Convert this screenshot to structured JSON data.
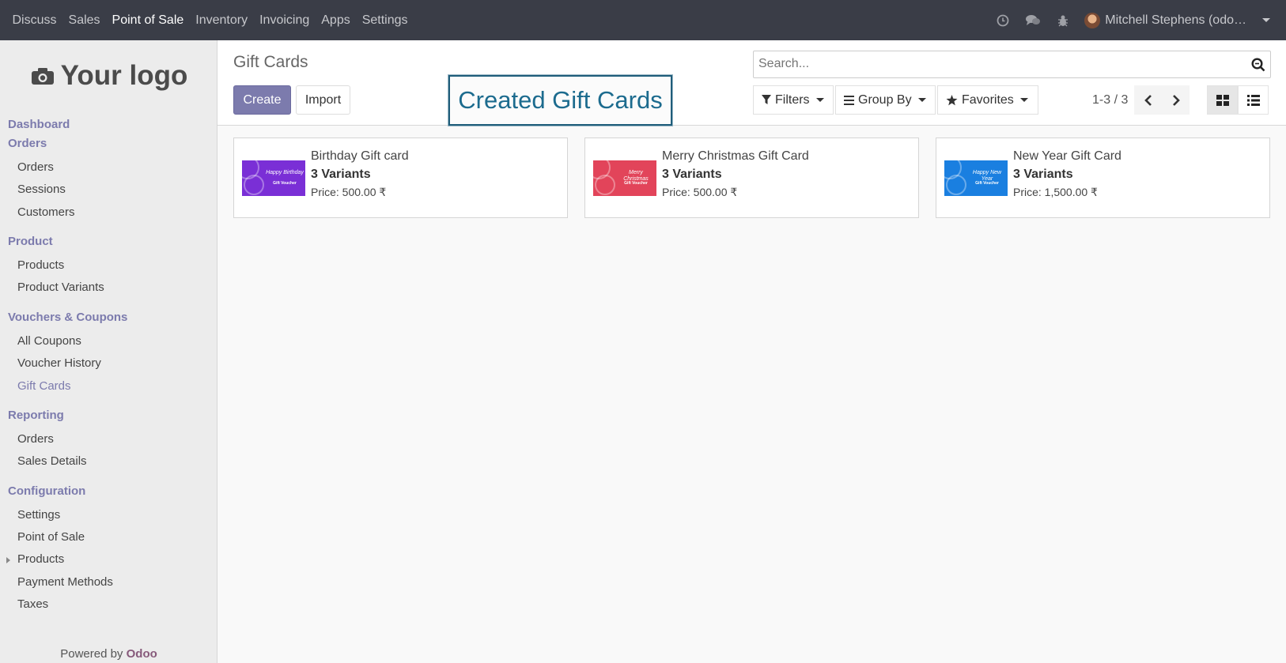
{
  "topbar": {
    "menus": [
      "Discuss",
      "Sales",
      "Point of Sale",
      "Inventory",
      "Invoicing",
      "Apps",
      "Settings"
    ],
    "active_menu": "Point of Sale",
    "user_name": "Mitchell Stephens (odo…",
    "icons": [
      "clock-icon",
      "chat-icon",
      "bug-icon"
    ]
  },
  "sidebar": {
    "logo_text": "Your logo",
    "dashboard": "Dashboard",
    "orders_head": "Orders",
    "orders_items": [
      "Orders",
      "Sessions",
      "Customers"
    ],
    "product_head": "Product",
    "product_items": [
      "Products",
      "Product Variants"
    ],
    "vouchers_head": "Vouchers & Coupons",
    "vouchers_items": [
      "All Coupons",
      "Voucher History",
      "Gift Cards"
    ],
    "reporting_head": "Reporting",
    "reporting_items": [
      "Orders",
      "Sales Details"
    ],
    "config_head": "Configuration",
    "config_items": [
      "Settings",
      "Point of Sale",
      "Products",
      "Payment Methods",
      "Taxes"
    ],
    "powered_prefix": "Powered by",
    "powered_brand": "Odoo"
  },
  "control": {
    "title": "Gift Cards",
    "create_label": "Create",
    "import_label": "Import",
    "callout": "Created Gift Cards",
    "search_placeholder": "Search...",
    "filters_label": "Filters",
    "groupby_label": "Group By",
    "favorites_label": "Favorites",
    "pager": "1-3 / 3"
  },
  "cards": [
    {
      "name": "Birthday Gift card",
      "variants": "3 Variants",
      "price": "Price: 500.00 ₹",
      "thumb_text": "Happy Birthday",
      "thumb_sub": "Gift Voucher",
      "color": "#7a2fd6"
    },
    {
      "name": "Merry Christmas Gift Card",
      "variants": "3 Variants",
      "price": "Price: 500.00 ₹",
      "thumb_text": "Merry Christmas",
      "thumb_sub": "Gift Voucher",
      "color": "#e2445a"
    },
    {
      "name": "New Year Gift Card",
      "variants": "3 Variants",
      "price": "Price: 1,500.00 ₹",
      "thumb_text": "Happy New Year",
      "thumb_sub": "Gift Voucher",
      "color": "#1a7fe0"
    }
  ]
}
